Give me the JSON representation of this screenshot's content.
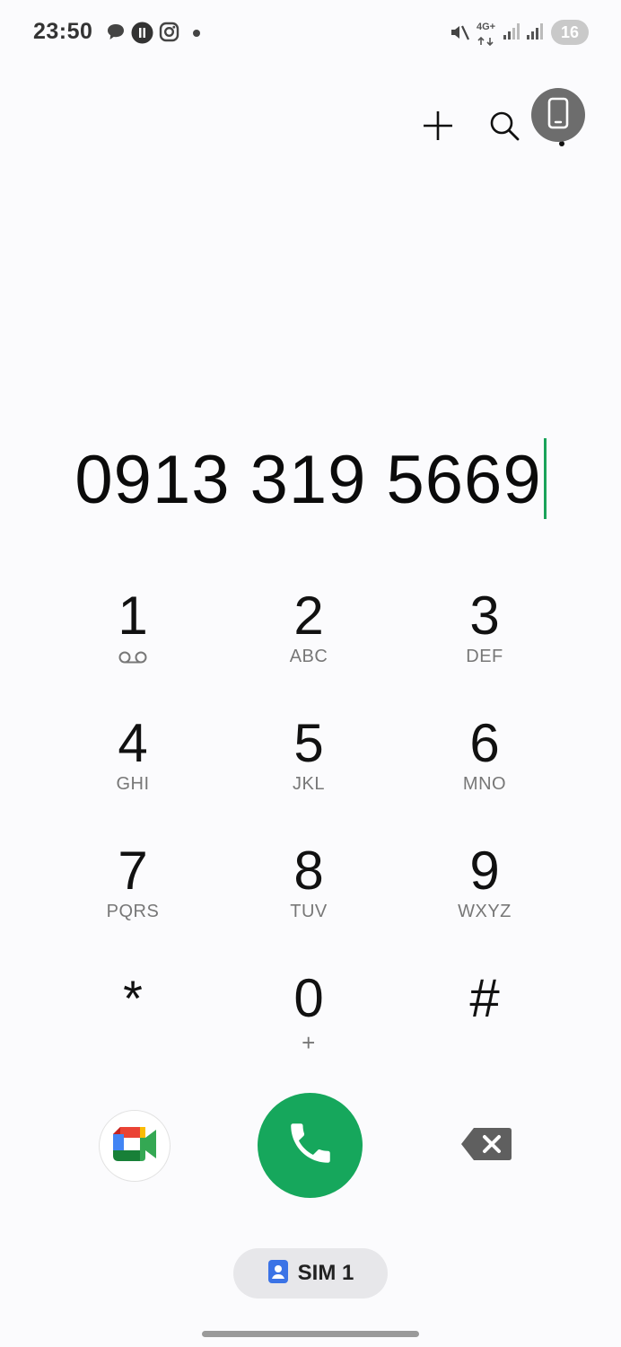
{
  "status_bar": {
    "time": "23:50",
    "network_label": "4G+",
    "battery_level": "16",
    "icons": [
      "chat-icon",
      "app-notification-icon",
      "instagram-icon",
      "more-notifications-dot",
      "vibrate-silent-icon",
      "signal-sim1-icon",
      "signal-sim2-icon"
    ]
  },
  "toolbar": {
    "add_icon": "plus-icon",
    "search_icon": "search-icon",
    "more_icon": "more-options-icon",
    "floating_icon": "phone-device-icon"
  },
  "dialer": {
    "number": "0913 319 5669"
  },
  "keypad": {
    "keys": [
      {
        "digit": "1",
        "letters": "",
        "icon": "voicemail-icon"
      },
      {
        "digit": "2",
        "letters": "ABC"
      },
      {
        "digit": "3",
        "letters": "DEF"
      },
      {
        "digit": "4",
        "letters": "GHI"
      },
      {
        "digit": "5",
        "letters": "JKL"
      },
      {
        "digit": "6",
        "letters": "MNO"
      },
      {
        "digit": "7",
        "letters": "PQRS"
      },
      {
        "digit": "8",
        "letters": "TUV"
      },
      {
        "digit": "9",
        "letters": "WXYZ"
      },
      {
        "digit": "*",
        "letters": ""
      },
      {
        "digit": "0",
        "letters": "+"
      },
      {
        "digit": "#",
        "letters": ""
      }
    ]
  },
  "actions": {
    "video_call_icon": "google-meet-icon",
    "call_icon": "phone-call-icon",
    "backspace_icon": "backspace-icon"
  },
  "sim": {
    "label": "SIM 1",
    "icon": "contact-card-icon"
  },
  "colors": {
    "call_green": "#16a75c",
    "cursor_green": "#1aa35a",
    "sim_chip_bg": "#e7e7ea",
    "sim_icon_blue": "#3b73e6"
  }
}
